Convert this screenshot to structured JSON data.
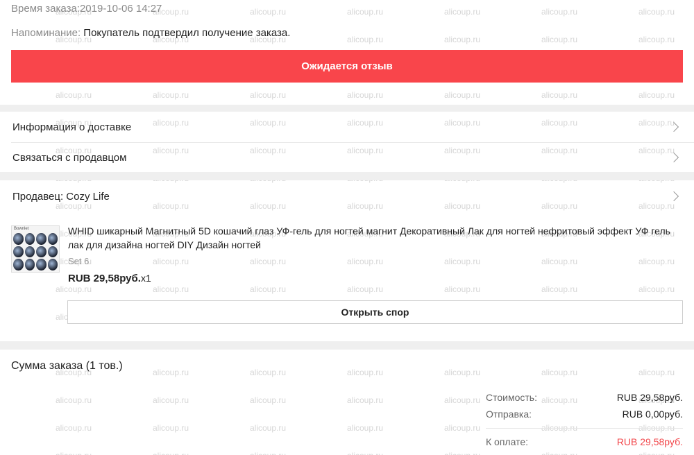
{
  "order": {
    "time_label": "Время заказа:",
    "time_value": "2019-10-06 14:27",
    "reminder_label": "Напоминание:",
    "reminder_text": " Покупатель подтвердил получение заказа.",
    "status_button": "Ожидается отзыв"
  },
  "menu": {
    "delivery_info": "Информация о доставке",
    "contact_seller": "Связаться с продавцом",
    "seller": "Продавец: Cozy Life"
  },
  "product": {
    "title": "WHID шикарный Магнитный 5D кошачий глаз УФ-гель для ногтей магнит Декоративный Лак для ногтей нефритовый эффект УФ гель лак для дизайна ногтей DIY Дизайн ногтей",
    "variant": "Set 6",
    "price": "RUB 29,58руб.",
    "quantity": "x1",
    "dispute_button": "Открыть спор"
  },
  "summary": {
    "title": "Сумма заказа (1 тов.)",
    "cost_label": "Стоимость:",
    "cost_value": "RUB 29,58руб.",
    "shipping_label": "Отправка:",
    "shipping_value": "RUB 0,00руб.",
    "total_label": "К оплате:",
    "total_value": "RUB 29,58руб."
  },
  "watermark": "alicoup.ru",
  "colors": {
    "accent": "#f9454b",
    "total_red": "#f2474b"
  }
}
